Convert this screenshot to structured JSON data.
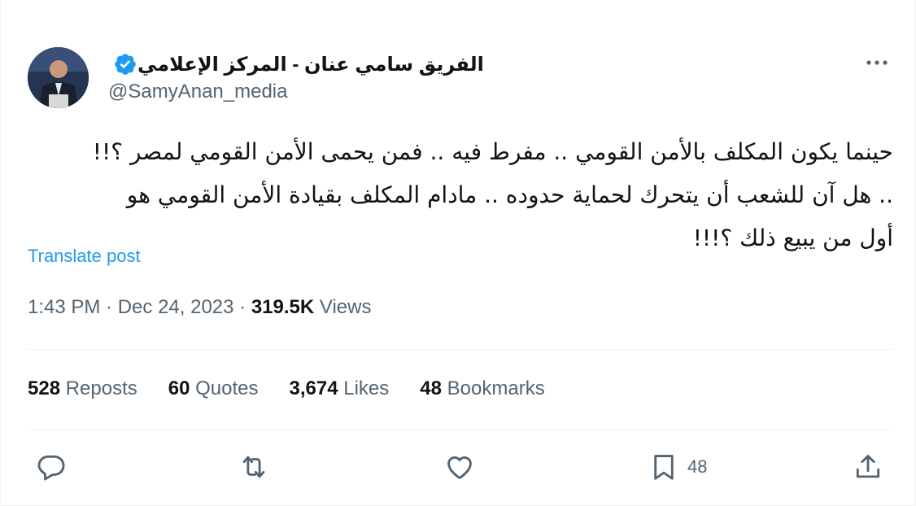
{
  "author": {
    "display_name": "الفريق سامي عنان - المركز الإعلامي",
    "handle": "@SamyAnan_media",
    "verified_icon": "verified-badge-icon",
    "badge_color": "#1d9bf0"
  },
  "tweet": {
    "lines": [
      "حينما يكون المكلف بالأمن القومي .. مفرط فيه .. فمن يحمى الأمن القومي لمصر ؟!!",
      ".. هل آن للشعب أن يتحرك لحماية حدوده .. مادام  المكلف بقيادة الأمن القومي هو",
      "أول من يبيع ذلك  ؟!!!"
    ],
    "translate_label": "Translate post"
  },
  "meta": {
    "time": "1:43 PM",
    "sep1": " · ",
    "date": "Dec 24, 2023",
    "sep2": " · ",
    "views_count": "319.5K",
    "views_label": " Views"
  },
  "stats": {
    "reposts_count": "528",
    "reposts_label": " Reposts",
    "quotes_count": "60",
    "quotes_label": " Quotes",
    "likes_count": "3,674",
    "likes_label": " Likes",
    "bookmarks_count": "48",
    "bookmarks_label": " Bookmarks"
  },
  "actions": {
    "reply_icon": "reply-icon",
    "retweet_icon": "retweet-icon",
    "like_icon": "heart-icon",
    "bookmark_icon": "bookmark-icon",
    "bookmark_count": "48",
    "share_icon": "share-icon"
  },
  "colors": {
    "text": "#0f1419",
    "secondary": "#536471",
    "accent": "#1d9bf0",
    "divider": "#eff3f4"
  }
}
